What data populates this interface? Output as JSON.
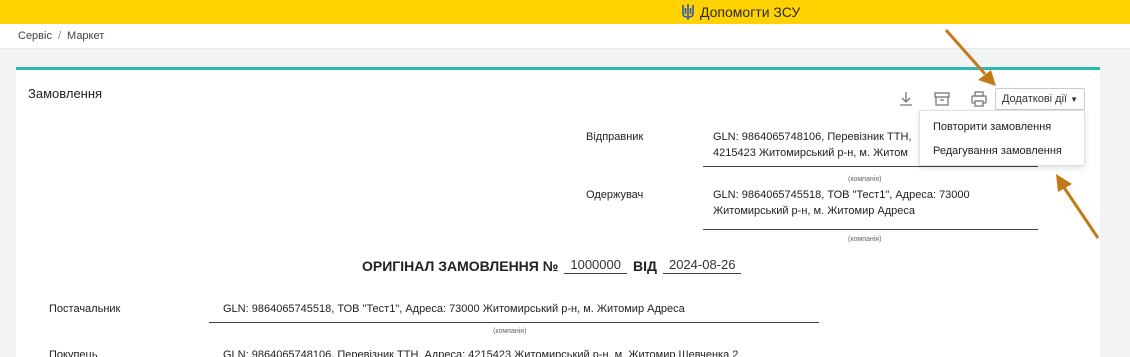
{
  "topbar": {
    "donate_label": "Допомогти ЗСУ"
  },
  "breadcrumb": {
    "items": [
      "Сервіс",
      "Маркет"
    ],
    "separator": "/"
  },
  "card": {
    "title": "Замовлення"
  },
  "toolbar": {
    "download_icon": "download-icon",
    "archive_icon": "archive-icon",
    "print_icon": "print-icon",
    "more_label": "Додаткові дії"
  },
  "menu": {
    "items": [
      "Повторити замовлення",
      "Редагування замовлення"
    ]
  },
  "sender": {
    "label": "Відправник",
    "line1": "GLN: 9864065748106, Перевізник ТТН,",
    "line2": "4215423 Житомирський р-н, м. Житом",
    "hint": "(компанія)"
  },
  "recipient": {
    "label": "Одержувач",
    "line1": "GLN: 9864065745518, ТОВ \"Тест1\", Адреса: 73000",
    "line2": "Житомирський р-н, м. Житомир Адреса",
    "hint": "(компанія)"
  },
  "order": {
    "title": "ОРИГІНАЛ ЗАМОВЛЕННЯ №",
    "number": "1000000",
    "from_label": "ВІД",
    "date": "2024-08-26"
  },
  "supplier": {
    "label": "Постачальник",
    "value": "GLN: 9864065745518, ТОВ \"Тест1\", Адреса: 73000 Житомирський р-н, м. Житомир Адреса",
    "hint": "(компанія)"
  },
  "buyer": {
    "label": "Покупець",
    "value": "GLN: 9864065748106, Перевізник ТТН, Адреса: 4215423 Житомирський р-н, м. Житомир Шевченка 2"
  },
  "colors": {
    "topbar": "#ffd200",
    "accent": "#2bbbad",
    "arrow": "#c27a19"
  }
}
